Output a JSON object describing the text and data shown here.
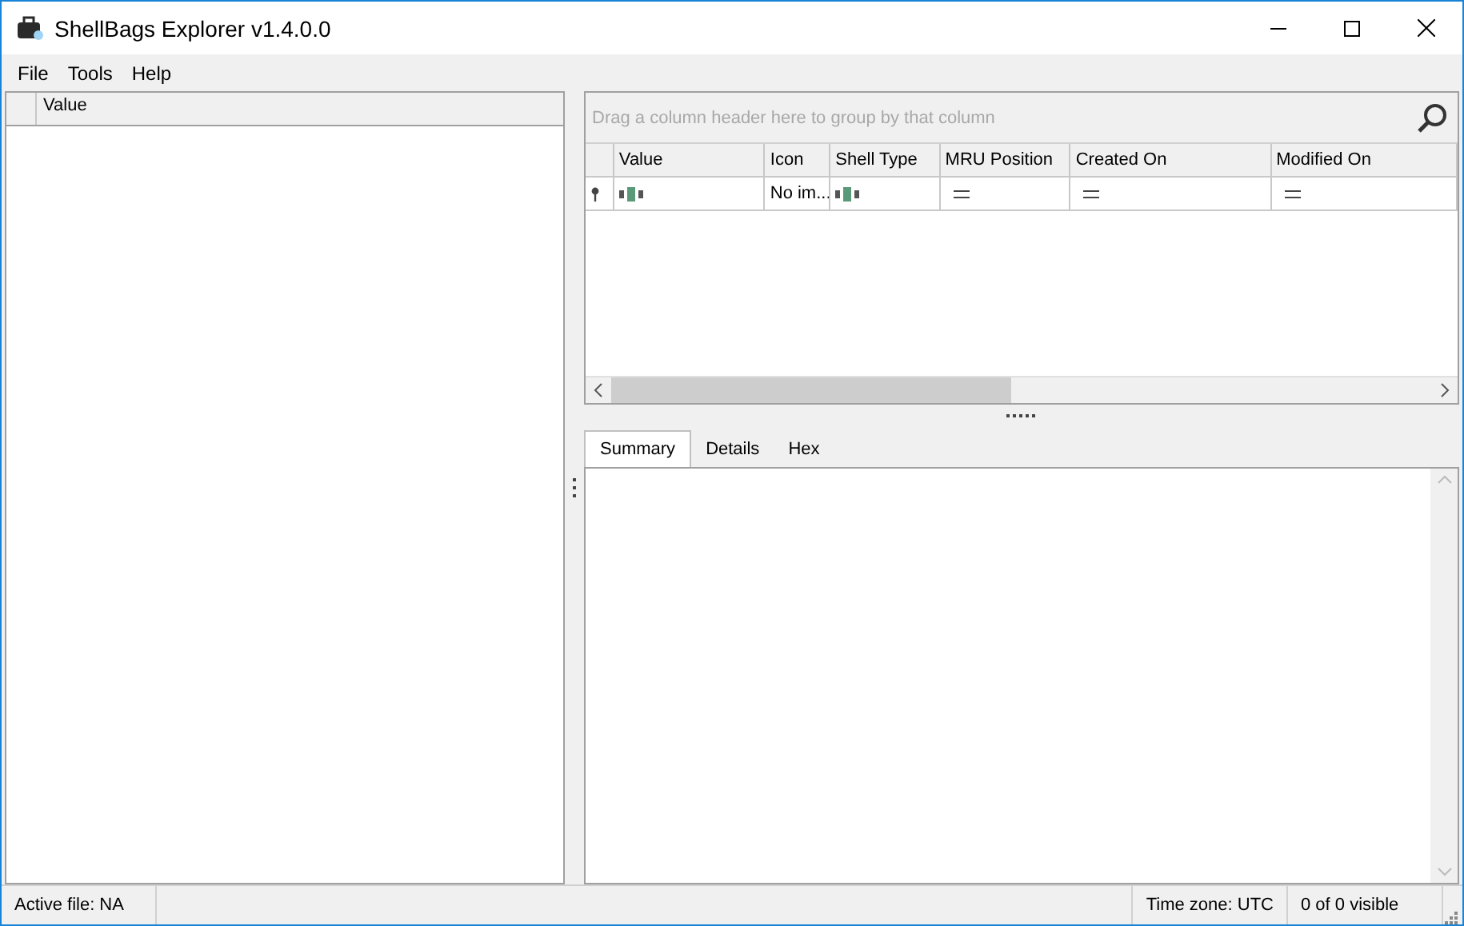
{
  "window": {
    "title": "ShellBags Explorer v1.4.0.0"
  },
  "menu": [
    "File",
    "Tools",
    "Help"
  ],
  "tree": {
    "columns": [
      "Value"
    ]
  },
  "grid": {
    "group_hint": "Drag a column header here to group by that column",
    "columns": [
      "Value",
      "Icon",
      "Shell Type",
      "MRU Position",
      "Created On",
      "Modified On"
    ],
    "filter_row": [
      {
        "kind": "text"
      },
      {
        "kind": "value",
        "text": "No im..."
      },
      {
        "kind": "text"
      },
      {
        "kind": "equals"
      },
      {
        "kind": "equals"
      },
      {
        "kind": "equals"
      }
    ]
  },
  "tabs": [
    {
      "label": "Summary",
      "selected": true
    },
    {
      "label": "Details",
      "selected": false
    },
    {
      "label": "Hex",
      "selected": false
    }
  ],
  "status_bar": {
    "active_file": "Active file: NA",
    "time_zone": "Time zone: UTC",
    "visible": "0 of 0 visible"
  }
}
